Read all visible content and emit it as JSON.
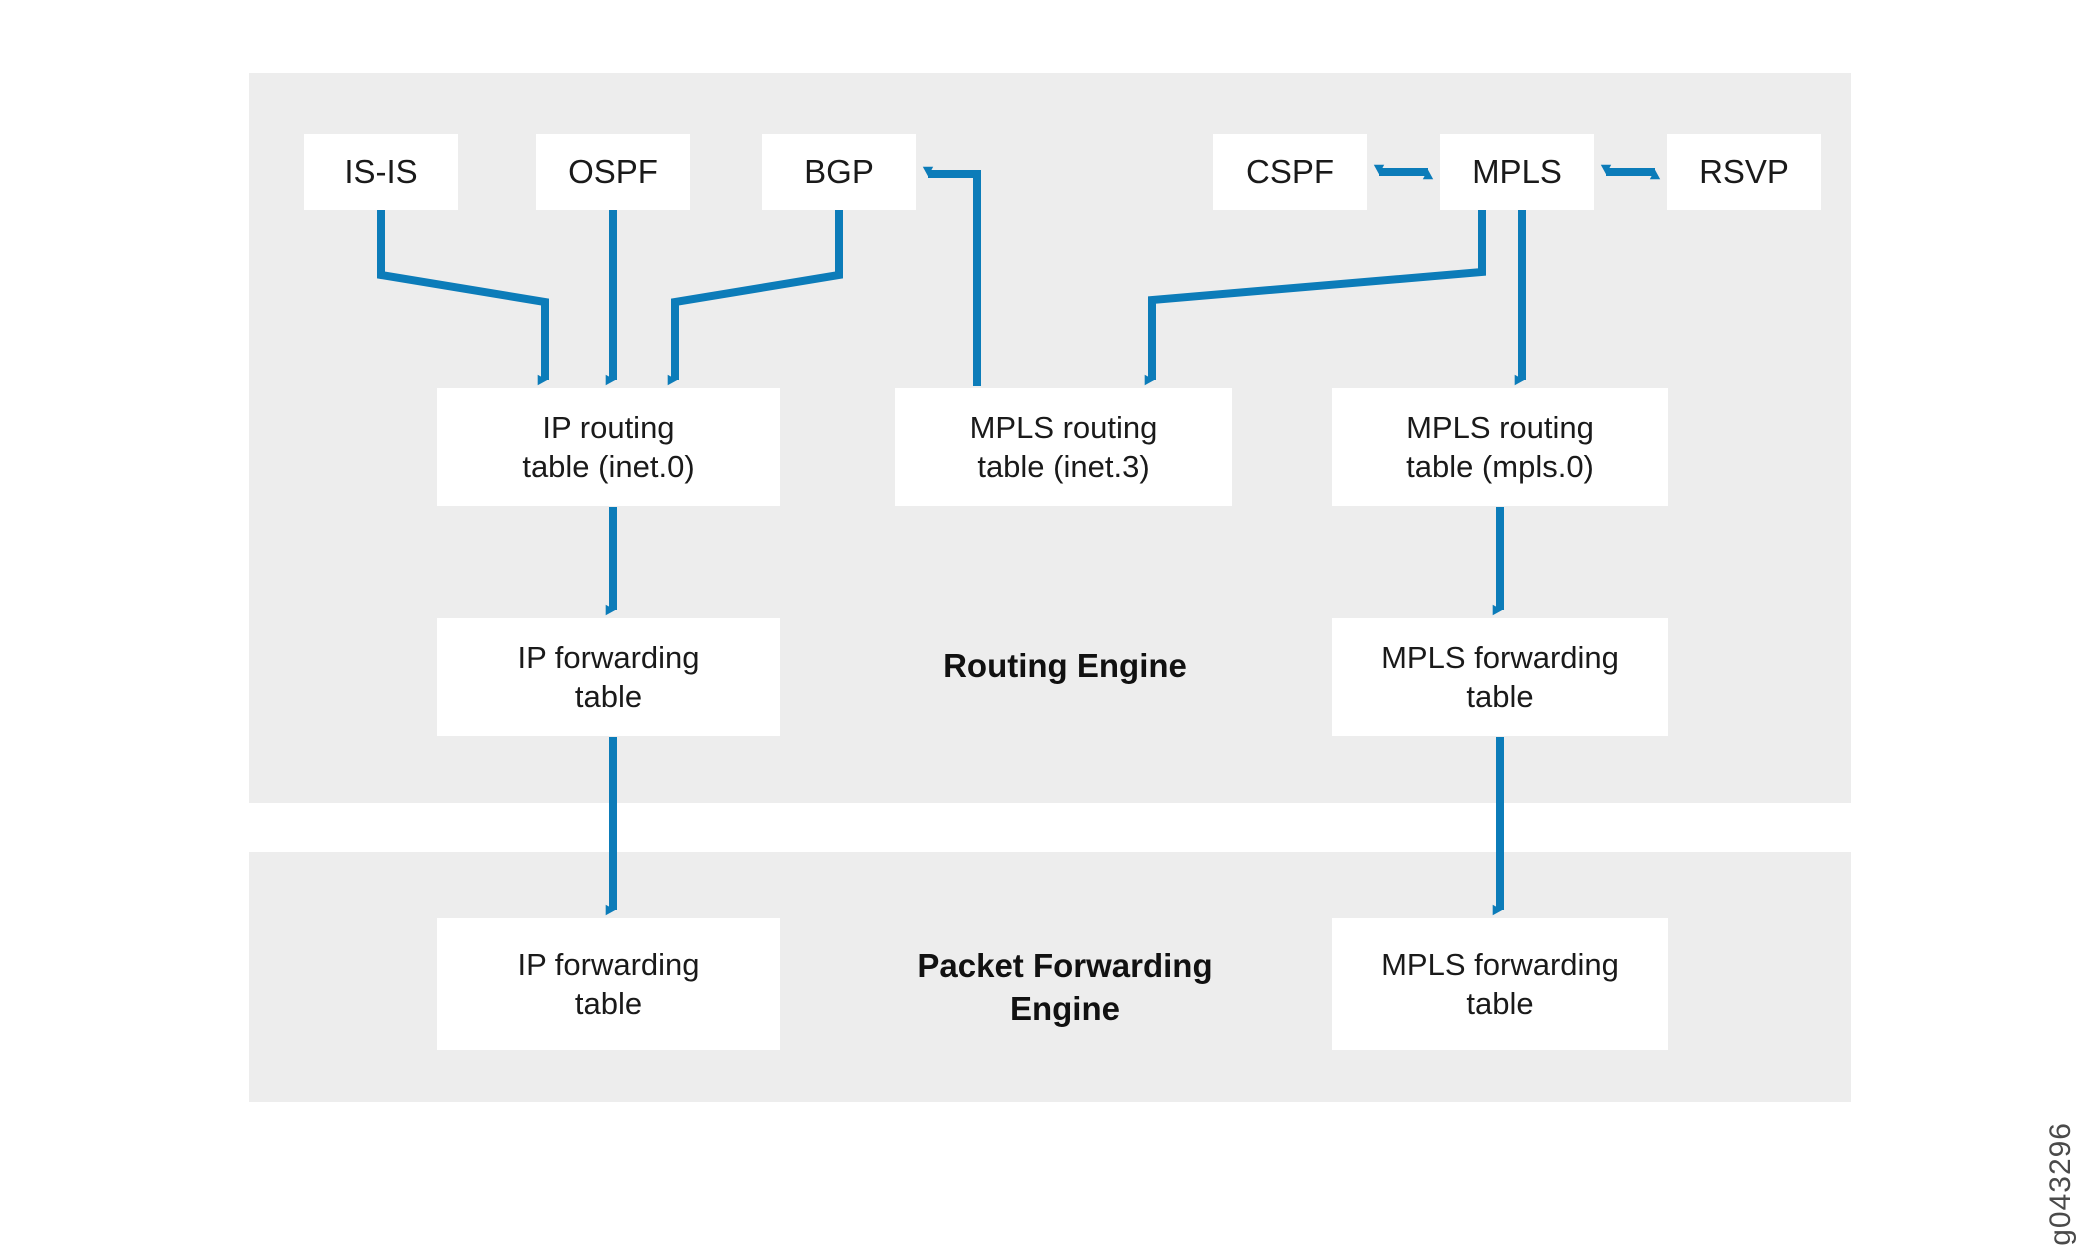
{
  "figure": {
    "id_label": "g043296",
    "accent_color": "#0c7cb9",
    "panel_color": "#ededed",
    "node_color": "#ffffff",
    "background_color": "#ffffff"
  },
  "panels": [
    {
      "key": "routing_engine",
      "label": "Routing Engine"
    },
    {
      "key": "packet_forwarding_engine",
      "label": "Packet Forwarding\nEngine"
    }
  ],
  "panel_labels": {
    "routing_engine": "Routing Engine",
    "packet_forwarding_engine_line1": "Packet Forwarding",
    "packet_forwarding_engine_line2": "Engine"
  },
  "nodes": {
    "isis": {
      "label": "IS-IS"
    },
    "ospf": {
      "label": "OSPF"
    },
    "bgp": {
      "label": "BGP"
    },
    "cspf": {
      "label": "CSPF"
    },
    "mpls": {
      "label": "MPLS"
    },
    "rsvp": {
      "label": "RSVP"
    },
    "inet0": {
      "line1": "IP routing",
      "line2": "table (inet.0)"
    },
    "inet3": {
      "line1": "MPLS routing",
      "line2": "table (inet.3)"
    },
    "mpls0": {
      "line1": "MPLS routing",
      "line2": "table (mpls.0)"
    },
    "ip_fwd_re": {
      "line1": "IP forwarding",
      "line2": "table"
    },
    "mpls_fwd_re": {
      "line1": "MPLS forwarding",
      "line2": "table"
    },
    "ip_fwd_pfe": {
      "line1": "IP forwarding",
      "line2": "table"
    },
    "mpls_fwd_pfe": {
      "line1": "MPLS forwarding",
      "line2": "table"
    }
  },
  "connections": [
    {
      "from": "inet0",
      "to": "isis",
      "type": "bidirectional-elbow"
    },
    {
      "from": "inet0",
      "to": "ospf",
      "type": "bidirectional-straight"
    },
    {
      "from": "inet0",
      "to": "bgp",
      "type": "bidirectional-elbow"
    },
    {
      "from": "inet3",
      "to": "bgp",
      "type": "unidirectional-elbow"
    },
    {
      "from": "cspf",
      "to": "mpls",
      "type": "bidirectional-horizontal"
    },
    {
      "from": "mpls",
      "to": "rsvp",
      "type": "bidirectional-horizontal"
    },
    {
      "from": "inet3",
      "to": "mpls",
      "type": "bidirectional-elbow"
    },
    {
      "from": "mpls0",
      "to": "mpls",
      "type": "bidirectional-straight"
    },
    {
      "from": "inet0",
      "to": "ip_fwd_re",
      "type": "unidirectional-down"
    },
    {
      "from": "mpls0",
      "to": "mpls_fwd_re",
      "type": "unidirectional-down"
    },
    {
      "from": "ip_fwd_re",
      "to": "ip_fwd_pfe",
      "type": "unidirectional-down"
    },
    {
      "from": "mpls_fwd_re",
      "to": "mpls_fwd_pfe",
      "type": "unidirectional-down"
    }
  ]
}
